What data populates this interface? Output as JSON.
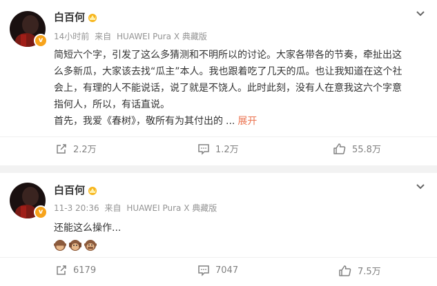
{
  "posts": [
    {
      "author": "白百何",
      "time": "14小时前",
      "source_prefix": "来自",
      "source": "HUAWEI Pura X 典藏版",
      "text_lines": [
        "简短六个字，引发了这么多猜测和不明所以的讨论。大家各带各的节奏，牵扯出这",
        "么多新瓜，大家该去找“瓜主”本人。我也跟着吃了几天的瓜。也让我知道在这个社",
        "会上，有理的人不能说话，说了就是不饶人。此时此刻，没有人在意我这六个字意",
        "指何人，所以，有话直说。"
      ],
      "last_line": "首先，我爱《春树》，敬所有为其付出的",
      "ellipsis": "...",
      "expand_label": "展开",
      "reposts": "2.2万",
      "comments": "1.2万",
      "likes": "55.8万"
    },
    {
      "author": "白百何",
      "time": "11-3 20:36",
      "source_prefix": "来自",
      "source": "HUAWEI Pura X 典藏版",
      "text": "还能这么操作...",
      "emojis": [
        "see-no-evil-monkey",
        "hear-no-evil-monkey",
        "speak-no-evil-monkey"
      ],
      "reposts": "6179",
      "comments": "7047",
      "likes": "7.5万"
    }
  ],
  "colors": {
    "verified_badge": "#f7a31b",
    "expand_link": "#eb7350",
    "meta_text": "#939393",
    "action_text": "#808080",
    "page_bg": "#f2f2f2"
  }
}
